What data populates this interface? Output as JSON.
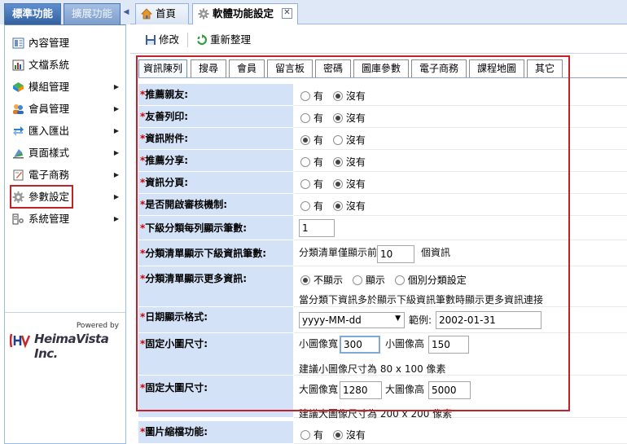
{
  "sidebar": {
    "tabs": [
      {
        "label": "標準功能"
      },
      {
        "label": "擴展功能"
      }
    ],
    "collapse_glyph": "◀",
    "items": [
      {
        "label": "內容管理",
        "icon": "content-icon",
        "has_arrow": false
      },
      {
        "label": "文檔系統",
        "icon": "document-system-icon",
        "has_arrow": false
      },
      {
        "label": "模組管理",
        "icon": "module-icon",
        "has_arrow": true
      },
      {
        "label": "會員管理",
        "icon": "members-icon",
        "has_arrow": true
      },
      {
        "label": "匯入匯出",
        "icon": "import-export-icon",
        "has_arrow": true
      },
      {
        "label": "頁面樣式",
        "icon": "page-style-icon",
        "has_arrow": true
      },
      {
        "label": "電子商務",
        "icon": "ecommerce-icon",
        "has_arrow": true
      },
      {
        "label": "參數設定",
        "icon": "gear-icon",
        "has_arrow": true
      },
      {
        "label": "系統管理",
        "icon": "system-icon",
        "has_arrow": true
      }
    ],
    "arrow_glyph": "▶",
    "powered_by": "Powered by",
    "brand": "HeimaVista Inc."
  },
  "header": {
    "tabs": [
      {
        "label": "首頁",
        "icon": "home-icon"
      },
      {
        "label": "軟體功能設定",
        "icon": "gear-icon"
      }
    ],
    "close_glyph": "✕"
  },
  "toolbar": {
    "edit_label": "修改",
    "refresh_label": "重新整理"
  },
  "sub_tabs": [
    "資訊陳列",
    "搜尋",
    "會員",
    "留言板",
    "密碼",
    "圖庫參數",
    "電子商務",
    "課程地圖",
    "其它"
  ],
  "options": {
    "yes": "有",
    "no": "沒有"
  },
  "form": {
    "recommend_friend": {
      "label": "推薦親友:",
      "selected": "no"
    },
    "friendly_print": {
      "label": "友善列印:",
      "selected": "no"
    },
    "info_attachment": {
      "label": "資訊附件:",
      "selected": "yes"
    },
    "recommend_share": {
      "label": "推薦分享:",
      "selected": "no"
    },
    "info_paging": {
      "label": "資訊分頁:",
      "selected": "no"
    },
    "review_mechanism": {
      "label": "是否開啟審核機制:",
      "selected": "no"
    },
    "sub_per_row": {
      "label": "下級分類每列顯示筆數:",
      "value": "1"
    },
    "sub_list_count": {
      "label": "分類清單顯示下級資訊筆數:",
      "prefix": "分類清單僅顯示前",
      "value": "10",
      "suffix": "個資訊"
    },
    "show_more": {
      "label": "分類清單顯示更多資訊:",
      "options": [
        "不顯示",
        "顯示",
        "個別分類設定"
      ],
      "selected": 0,
      "note": "當分類下資訊多於顯示下級資訊筆數時顯示更多資訊連接"
    },
    "date_format": {
      "label": "日期顯示格式:",
      "value": "yyyy-MM-dd",
      "example_label": "範例:",
      "example": "2002-01-31"
    },
    "small_image": {
      "label": "固定小圖尺寸:",
      "width_label": "小圖像寬",
      "width": "300",
      "height_label": "小圖像高",
      "height": "150",
      "note": "建議小圖像尺寸為 80 x 100 像素"
    },
    "large_image": {
      "label": "固定大圖尺寸:",
      "width_label": "大圖像寬",
      "width": "1280",
      "height_label": "大圖像高",
      "height": "5000",
      "note": "建議大圖像尺寸為 200 x 200 像素"
    },
    "image_zoom": {
      "label": "圖片縮檔功能:",
      "selected": "no"
    }
  },
  "colors": {
    "accent": "#c0232c",
    "label_bg": "#d3e2f7",
    "tab_blue": "#33609f"
  }
}
